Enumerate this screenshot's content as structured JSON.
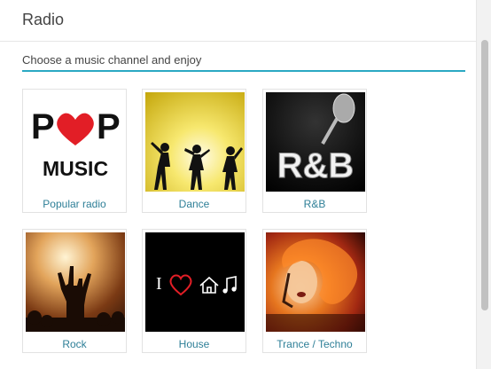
{
  "header": {
    "title": "Radio"
  },
  "search": {
    "prompt": "Choose a music channel and enjoy"
  },
  "channels": [
    {
      "label": "Popular radio",
      "art": {
        "word1": "POP",
        "word2": "MUSIC"
      }
    },
    {
      "label": "Dance"
    },
    {
      "label": "R&B",
      "art": {
        "text": "R&B"
      }
    },
    {
      "label": "Rock"
    },
    {
      "label": "House",
      "art": {
        "symbols": "I ♡ ⌂ ♫"
      }
    },
    {
      "label": "Trance / Techno"
    }
  ],
  "colors": {
    "accent": "#2aa9c3",
    "label": "#2e7f97",
    "heart": "#e21e26"
  }
}
